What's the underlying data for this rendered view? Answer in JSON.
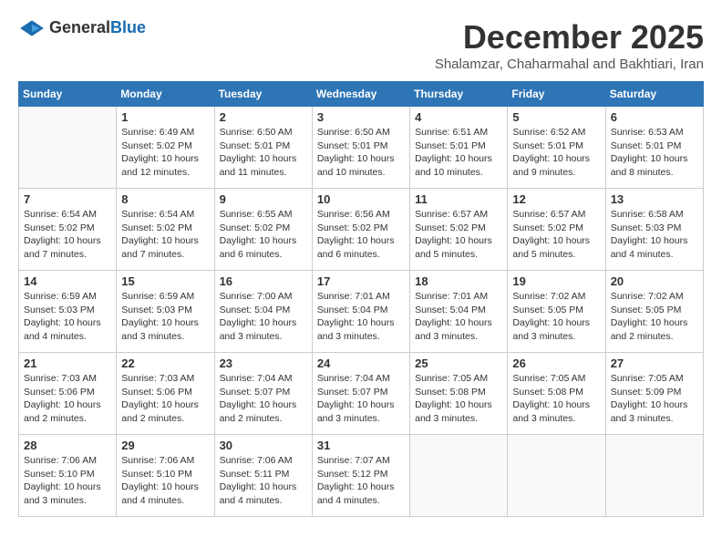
{
  "logo": {
    "general": "General",
    "blue": "Blue"
  },
  "title": "December 2025",
  "subtitle": "Shalamzar, Chaharmahal and Bakhtiari, Iran",
  "days_of_week": [
    "Sunday",
    "Monday",
    "Tuesday",
    "Wednesday",
    "Thursday",
    "Friday",
    "Saturday"
  ],
  "weeks": [
    [
      {
        "day": "",
        "info": ""
      },
      {
        "day": "1",
        "info": "Sunrise: 6:49 AM\nSunset: 5:02 PM\nDaylight: 10 hours\nand 12 minutes."
      },
      {
        "day": "2",
        "info": "Sunrise: 6:50 AM\nSunset: 5:01 PM\nDaylight: 10 hours\nand 11 minutes."
      },
      {
        "day": "3",
        "info": "Sunrise: 6:50 AM\nSunset: 5:01 PM\nDaylight: 10 hours\nand 10 minutes."
      },
      {
        "day": "4",
        "info": "Sunrise: 6:51 AM\nSunset: 5:01 PM\nDaylight: 10 hours\nand 10 minutes."
      },
      {
        "day": "5",
        "info": "Sunrise: 6:52 AM\nSunset: 5:01 PM\nDaylight: 10 hours\nand 9 minutes."
      },
      {
        "day": "6",
        "info": "Sunrise: 6:53 AM\nSunset: 5:01 PM\nDaylight: 10 hours\nand 8 minutes."
      }
    ],
    [
      {
        "day": "7",
        "info": "Sunrise: 6:54 AM\nSunset: 5:02 PM\nDaylight: 10 hours\nand 7 minutes."
      },
      {
        "day": "8",
        "info": "Sunrise: 6:54 AM\nSunset: 5:02 PM\nDaylight: 10 hours\nand 7 minutes."
      },
      {
        "day": "9",
        "info": "Sunrise: 6:55 AM\nSunset: 5:02 PM\nDaylight: 10 hours\nand 6 minutes."
      },
      {
        "day": "10",
        "info": "Sunrise: 6:56 AM\nSunset: 5:02 PM\nDaylight: 10 hours\nand 6 minutes."
      },
      {
        "day": "11",
        "info": "Sunrise: 6:57 AM\nSunset: 5:02 PM\nDaylight: 10 hours\nand 5 minutes."
      },
      {
        "day": "12",
        "info": "Sunrise: 6:57 AM\nSunset: 5:02 PM\nDaylight: 10 hours\nand 5 minutes."
      },
      {
        "day": "13",
        "info": "Sunrise: 6:58 AM\nSunset: 5:03 PM\nDaylight: 10 hours\nand 4 minutes."
      }
    ],
    [
      {
        "day": "14",
        "info": "Sunrise: 6:59 AM\nSunset: 5:03 PM\nDaylight: 10 hours\nand 4 minutes."
      },
      {
        "day": "15",
        "info": "Sunrise: 6:59 AM\nSunset: 5:03 PM\nDaylight: 10 hours\nand 3 minutes."
      },
      {
        "day": "16",
        "info": "Sunrise: 7:00 AM\nSunset: 5:04 PM\nDaylight: 10 hours\nand 3 minutes."
      },
      {
        "day": "17",
        "info": "Sunrise: 7:01 AM\nSunset: 5:04 PM\nDaylight: 10 hours\nand 3 minutes."
      },
      {
        "day": "18",
        "info": "Sunrise: 7:01 AM\nSunset: 5:04 PM\nDaylight: 10 hours\nand 3 minutes."
      },
      {
        "day": "19",
        "info": "Sunrise: 7:02 AM\nSunset: 5:05 PM\nDaylight: 10 hours\nand 3 minutes."
      },
      {
        "day": "20",
        "info": "Sunrise: 7:02 AM\nSunset: 5:05 PM\nDaylight: 10 hours\nand 2 minutes."
      }
    ],
    [
      {
        "day": "21",
        "info": "Sunrise: 7:03 AM\nSunset: 5:06 PM\nDaylight: 10 hours\nand 2 minutes."
      },
      {
        "day": "22",
        "info": "Sunrise: 7:03 AM\nSunset: 5:06 PM\nDaylight: 10 hours\nand 2 minutes."
      },
      {
        "day": "23",
        "info": "Sunrise: 7:04 AM\nSunset: 5:07 PM\nDaylight: 10 hours\nand 2 minutes."
      },
      {
        "day": "24",
        "info": "Sunrise: 7:04 AM\nSunset: 5:07 PM\nDaylight: 10 hours\nand 3 minutes."
      },
      {
        "day": "25",
        "info": "Sunrise: 7:05 AM\nSunset: 5:08 PM\nDaylight: 10 hours\nand 3 minutes."
      },
      {
        "day": "26",
        "info": "Sunrise: 7:05 AM\nSunset: 5:08 PM\nDaylight: 10 hours\nand 3 minutes."
      },
      {
        "day": "27",
        "info": "Sunrise: 7:05 AM\nSunset: 5:09 PM\nDaylight: 10 hours\nand 3 minutes."
      }
    ],
    [
      {
        "day": "28",
        "info": "Sunrise: 7:06 AM\nSunset: 5:10 PM\nDaylight: 10 hours\nand 3 minutes."
      },
      {
        "day": "29",
        "info": "Sunrise: 7:06 AM\nSunset: 5:10 PM\nDaylight: 10 hours\nand 4 minutes."
      },
      {
        "day": "30",
        "info": "Sunrise: 7:06 AM\nSunset: 5:11 PM\nDaylight: 10 hours\nand 4 minutes."
      },
      {
        "day": "31",
        "info": "Sunrise: 7:07 AM\nSunset: 5:12 PM\nDaylight: 10 hours\nand 4 minutes."
      },
      {
        "day": "",
        "info": ""
      },
      {
        "day": "",
        "info": ""
      },
      {
        "day": "",
        "info": ""
      }
    ]
  ]
}
